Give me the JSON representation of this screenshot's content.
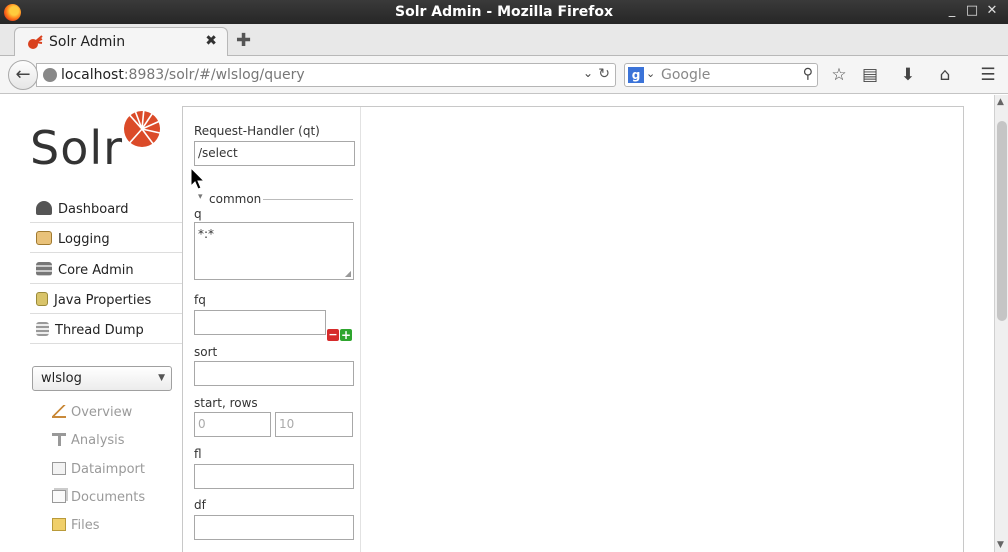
{
  "window": {
    "title": "Solr Admin - Mozilla Firefox",
    "min": "_",
    "max": "□",
    "close": "✕"
  },
  "tab": {
    "label": "Solr Admin",
    "close": "✖",
    "new_tab": "✚"
  },
  "nav": {
    "back": "←",
    "url_host": "localhost",
    "url_rest": ":8983/solr/#/wlslog/query",
    "search_placeholder": "Google",
    "icons": [
      "bookmark-star-icon",
      "reading-list-icon",
      "download-icon",
      "home-icon",
      "menu-icon"
    ]
  },
  "sidebar": {
    "logo_text": "Solr",
    "items": [
      {
        "label": "Dashboard",
        "icon": "dashboard-icon",
        "color": "#555555"
      },
      {
        "label": "Logging",
        "icon": "logging-icon",
        "color": "#d8a548"
      },
      {
        "label": "Core Admin",
        "icon": "core-admin-icon",
        "color": "#7a7a7a"
      },
      {
        "label": "Java Properties",
        "icon": "java-properties-icon",
        "color": "#c8b04a"
      },
      {
        "label": "Thread Dump",
        "icon": "thread-dump-icon",
        "color": "#888888"
      }
    ],
    "core_selector": {
      "value": "wlslog"
    },
    "core_items": [
      {
        "label": "Overview",
        "icon": "overview-icon"
      },
      {
        "label": "Analysis",
        "icon": "analysis-icon"
      },
      {
        "label": "Dataimport",
        "icon": "dataimport-icon"
      },
      {
        "label": "Documents",
        "icon": "documents-icon"
      },
      {
        "label": "Files",
        "icon": "files-icon"
      }
    ]
  },
  "query": {
    "request_handler_label": "Request-Handler (qt)",
    "request_handler_value": "/select",
    "section_common": "common",
    "q_label": "q",
    "q_value": "*:*",
    "fq_label": "fq",
    "fq_value": "",
    "sort_label": "sort",
    "sort_value": "",
    "start_rows_label": "start, rows",
    "start_placeholder": "0",
    "rows_placeholder": "10",
    "fl_label": "fl",
    "fl_value": "",
    "df_label": "df",
    "df_value": ""
  },
  "colors": {
    "solr_red": "#d9411e",
    "add_green": "#2ea52e",
    "remove_red": "#d62b2b"
  }
}
